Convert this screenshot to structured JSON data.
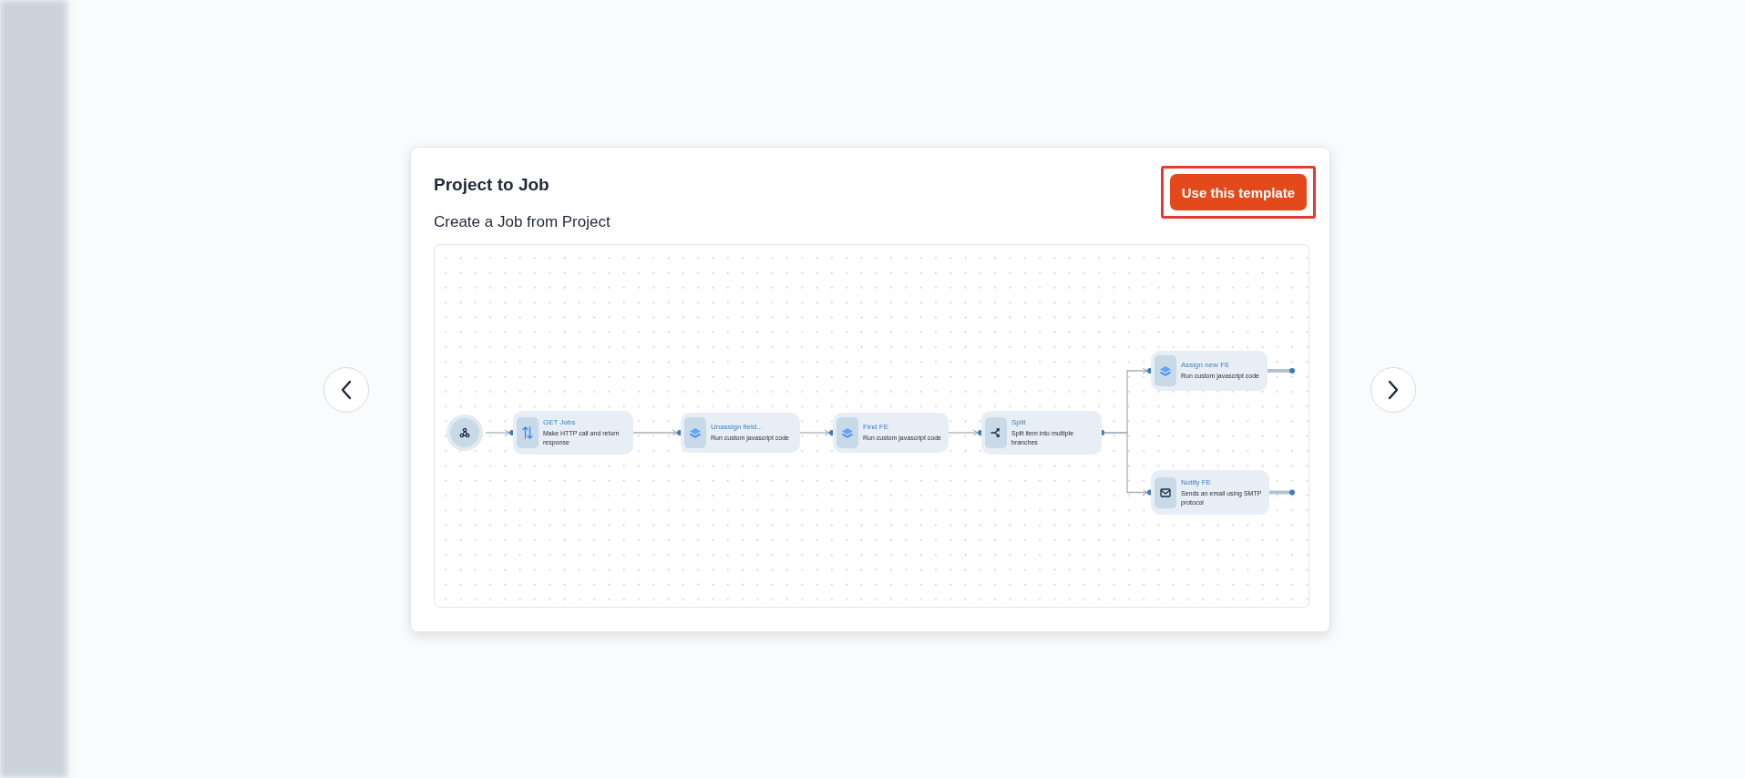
{
  "modal": {
    "title": "Project to Job",
    "subtitle": "Create a Job from Project",
    "action": {
      "label": "Use this template",
      "highlighted": true
    }
  },
  "diagram": {
    "root": {
      "kind": "trigger",
      "children": [
        {
          "kind": "http",
          "title": "GET Jobs",
          "description": "Make HTTP call and return response",
          "children": [
            {
              "kind": "code",
              "title": "Unassign field...",
              "description": "Run custom javascript code",
              "children": [
                {
                  "kind": "code",
                  "title": "Find FE",
                  "description": "Run custom javascript code",
                  "children": [
                    {
                      "kind": "split",
                      "title": "Split",
                      "description": "Split item into multiple branches",
                      "children": [
                        {
                          "kind": "code",
                          "title": "Assign new FE",
                          "description": "Run custom javascript code",
                          "open_output": true
                        },
                        {
                          "kind": "email",
                          "title": "Notify FE",
                          "description": "Sends an email using SMTP protocol",
                          "open_output": true
                        }
                      ]
                    }
                  ]
                }
              ]
            }
          ]
        }
      ]
    }
  }
}
